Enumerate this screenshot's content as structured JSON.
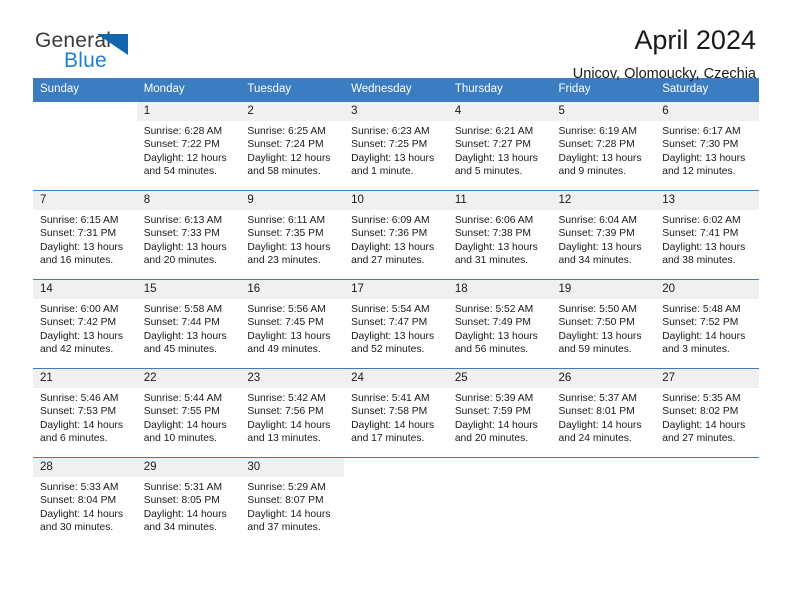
{
  "brand": {
    "name_part1": "General",
    "name_part2": "Blue",
    "logo_icon": "triangle-flag-icon"
  },
  "header": {
    "title": "April 2024",
    "subtitle": "Unicov, Olomoucky, Czechia"
  },
  "calendar": {
    "weekday_headers": [
      "Sunday",
      "Monday",
      "Tuesday",
      "Wednesday",
      "Thursday",
      "Friday",
      "Saturday"
    ],
    "accent_color": "#3b7dc0",
    "daynum_background": "#f0f0f0",
    "weeks": [
      [
        {
          "day": "",
          "sunrise": "",
          "sunset": "",
          "daylight_line1": "",
          "daylight_line2": ""
        },
        {
          "day": "1",
          "sunrise": "Sunrise: 6:28 AM",
          "sunset": "Sunset: 7:22 PM",
          "daylight_line1": "Daylight: 12 hours",
          "daylight_line2": "and 54 minutes."
        },
        {
          "day": "2",
          "sunrise": "Sunrise: 6:25 AM",
          "sunset": "Sunset: 7:24 PM",
          "daylight_line1": "Daylight: 12 hours",
          "daylight_line2": "and 58 minutes."
        },
        {
          "day": "3",
          "sunrise": "Sunrise: 6:23 AM",
          "sunset": "Sunset: 7:25 PM",
          "daylight_line1": "Daylight: 13 hours",
          "daylight_line2": "and 1 minute."
        },
        {
          "day": "4",
          "sunrise": "Sunrise: 6:21 AM",
          "sunset": "Sunset: 7:27 PM",
          "daylight_line1": "Daylight: 13 hours",
          "daylight_line2": "and 5 minutes."
        },
        {
          "day": "5",
          "sunrise": "Sunrise: 6:19 AM",
          "sunset": "Sunset: 7:28 PM",
          "daylight_line1": "Daylight: 13 hours",
          "daylight_line2": "and 9 minutes."
        },
        {
          "day": "6",
          "sunrise": "Sunrise: 6:17 AM",
          "sunset": "Sunset: 7:30 PM",
          "daylight_line1": "Daylight: 13 hours",
          "daylight_line2": "and 12 minutes."
        }
      ],
      [
        {
          "day": "7",
          "sunrise": "Sunrise: 6:15 AM",
          "sunset": "Sunset: 7:31 PM",
          "daylight_line1": "Daylight: 13 hours",
          "daylight_line2": "and 16 minutes."
        },
        {
          "day": "8",
          "sunrise": "Sunrise: 6:13 AM",
          "sunset": "Sunset: 7:33 PM",
          "daylight_line1": "Daylight: 13 hours",
          "daylight_line2": "and 20 minutes."
        },
        {
          "day": "9",
          "sunrise": "Sunrise: 6:11 AM",
          "sunset": "Sunset: 7:35 PM",
          "daylight_line1": "Daylight: 13 hours",
          "daylight_line2": "and 23 minutes."
        },
        {
          "day": "10",
          "sunrise": "Sunrise: 6:09 AM",
          "sunset": "Sunset: 7:36 PM",
          "daylight_line1": "Daylight: 13 hours",
          "daylight_line2": "and 27 minutes."
        },
        {
          "day": "11",
          "sunrise": "Sunrise: 6:06 AM",
          "sunset": "Sunset: 7:38 PM",
          "daylight_line1": "Daylight: 13 hours",
          "daylight_line2": "and 31 minutes."
        },
        {
          "day": "12",
          "sunrise": "Sunrise: 6:04 AM",
          "sunset": "Sunset: 7:39 PM",
          "daylight_line1": "Daylight: 13 hours",
          "daylight_line2": "and 34 minutes."
        },
        {
          "day": "13",
          "sunrise": "Sunrise: 6:02 AM",
          "sunset": "Sunset: 7:41 PM",
          "daylight_line1": "Daylight: 13 hours",
          "daylight_line2": "and 38 minutes."
        }
      ],
      [
        {
          "day": "14",
          "sunrise": "Sunrise: 6:00 AM",
          "sunset": "Sunset: 7:42 PM",
          "daylight_line1": "Daylight: 13 hours",
          "daylight_line2": "and 42 minutes."
        },
        {
          "day": "15",
          "sunrise": "Sunrise: 5:58 AM",
          "sunset": "Sunset: 7:44 PM",
          "daylight_line1": "Daylight: 13 hours",
          "daylight_line2": "and 45 minutes."
        },
        {
          "day": "16",
          "sunrise": "Sunrise: 5:56 AM",
          "sunset": "Sunset: 7:45 PM",
          "daylight_line1": "Daylight: 13 hours",
          "daylight_line2": "and 49 minutes."
        },
        {
          "day": "17",
          "sunrise": "Sunrise: 5:54 AM",
          "sunset": "Sunset: 7:47 PM",
          "daylight_line1": "Daylight: 13 hours",
          "daylight_line2": "and 52 minutes."
        },
        {
          "day": "18",
          "sunrise": "Sunrise: 5:52 AM",
          "sunset": "Sunset: 7:49 PM",
          "daylight_line1": "Daylight: 13 hours",
          "daylight_line2": "and 56 minutes."
        },
        {
          "day": "19",
          "sunrise": "Sunrise: 5:50 AM",
          "sunset": "Sunset: 7:50 PM",
          "daylight_line1": "Daylight: 13 hours",
          "daylight_line2": "and 59 minutes."
        },
        {
          "day": "20",
          "sunrise": "Sunrise: 5:48 AM",
          "sunset": "Sunset: 7:52 PM",
          "daylight_line1": "Daylight: 14 hours",
          "daylight_line2": "and 3 minutes."
        }
      ],
      [
        {
          "day": "21",
          "sunrise": "Sunrise: 5:46 AM",
          "sunset": "Sunset: 7:53 PM",
          "daylight_line1": "Daylight: 14 hours",
          "daylight_line2": "and 6 minutes."
        },
        {
          "day": "22",
          "sunrise": "Sunrise: 5:44 AM",
          "sunset": "Sunset: 7:55 PM",
          "daylight_line1": "Daylight: 14 hours",
          "daylight_line2": "and 10 minutes."
        },
        {
          "day": "23",
          "sunrise": "Sunrise: 5:42 AM",
          "sunset": "Sunset: 7:56 PM",
          "daylight_line1": "Daylight: 14 hours",
          "daylight_line2": "and 13 minutes."
        },
        {
          "day": "24",
          "sunrise": "Sunrise: 5:41 AM",
          "sunset": "Sunset: 7:58 PM",
          "daylight_line1": "Daylight: 14 hours",
          "daylight_line2": "and 17 minutes."
        },
        {
          "day": "25",
          "sunrise": "Sunrise: 5:39 AM",
          "sunset": "Sunset: 7:59 PM",
          "daylight_line1": "Daylight: 14 hours",
          "daylight_line2": "and 20 minutes."
        },
        {
          "day": "26",
          "sunrise": "Sunrise: 5:37 AM",
          "sunset": "Sunset: 8:01 PM",
          "daylight_line1": "Daylight: 14 hours",
          "daylight_line2": "and 24 minutes."
        },
        {
          "day": "27",
          "sunrise": "Sunrise: 5:35 AM",
          "sunset": "Sunset: 8:02 PM",
          "daylight_line1": "Daylight: 14 hours",
          "daylight_line2": "and 27 minutes."
        }
      ],
      [
        {
          "day": "28",
          "sunrise": "Sunrise: 5:33 AM",
          "sunset": "Sunset: 8:04 PM",
          "daylight_line1": "Daylight: 14 hours",
          "daylight_line2": "and 30 minutes."
        },
        {
          "day": "29",
          "sunrise": "Sunrise: 5:31 AM",
          "sunset": "Sunset: 8:05 PM",
          "daylight_line1": "Daylight: 14 hours",
          "daylight_line2": "and 34 minutes."
        },
        {
          "day": "30",
          "sunrise": "Sunrise: 5:29 AM",
          "sunset": "Sunset: 8:07 PM",
          "daylight_line1": "Daylight: 14 hours",
          "daylight_line2": "and 37 minutes."
        },
        {
          "day": "",
          "sunrise": "",
          "sunset": "",
          "daylight_line1": "",
          "daylight_line2": ""
        },
        {
          "day": "",
          "sunrise": "",
          "sunset": "",
          "daylight_line1": "",
          "daylight_line2": ""
        },
        {
          "day": "",
          "sunrise": "",
          "sunset": "",
          "daylight_line1": "",
          "daylight_line2": ""
        },
        {
          "day": "",
          "sunrise": "",
          "sunset": "",
          "daylight_line1": "",
          "daylight_line2": ""
        }
      ]
    ]
  }
}
